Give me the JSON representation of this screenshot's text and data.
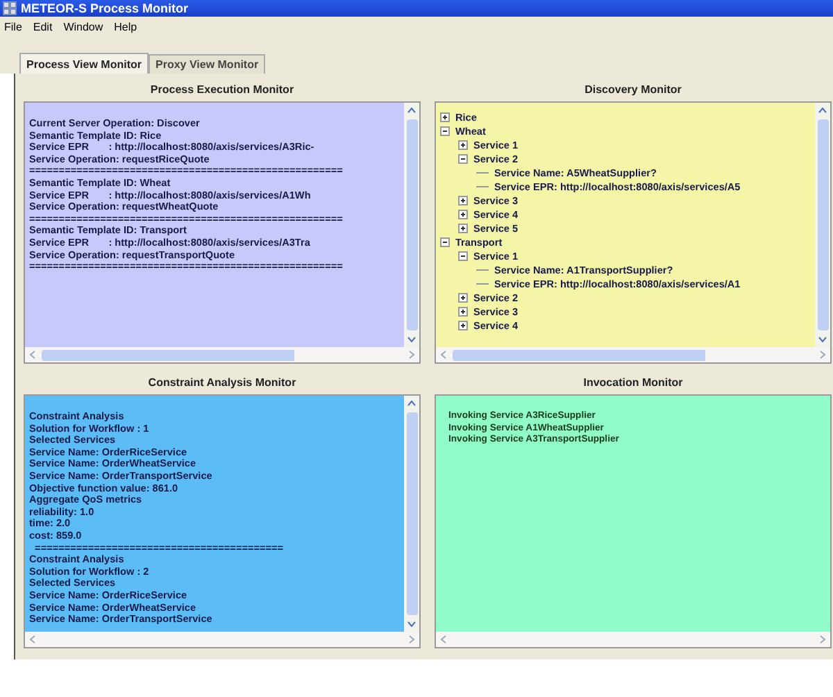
{
  "window": {
    "title": "METEOR-S Process Monitor"
  },
  "menu": [
    "File",
    "Edit",
    "Window",
    "Help"
  ],
  "tabs": [
    {
      "label": "Process View Monitor",
      "selected": true
    },
    {
      "label": "Proxy View Monitor",
      "selected": false
    }
  ],
  "panels": [
    {
      "title": "Process Execution Monitor",
      "kind": "text",
      "color": "#c8c8fa",
      "vertical_scrollbar": true,
      "lines": [
        "Current Server Operation: Discover",
        "Semantic Template ID: Rice",
        "Service EPR       : http://localhost:8080/axis/services/A3Ric-",
        "Service Operation: requestRiceQuote",
        "=====================================================",
        "Semantic Template ID: Wheat",
        "Service EPR       : http://localhost:8080/axis/services/A1Wh",
        "Service Operation: requestWheatQuote",
        "=====================================================",
        "Semantic Template ID: Transport",
        "Service EPR       : http://localhost:8080/axis/services/A3Tra",
        "Service Operation: requestTransportQuote",
        "====================================================="
      ]
    },
    {
      "title": "Discovery Monitor",
      "kind": "tree",
      "color": "#f5f5a8",
      "vertical_scrollbar": true,
      "nodes": [
        {
          "label": "Rice",
          "kind": "node",
          "expanded": false
        },
        {
          "label": "Wheat",
          "kind": "node",
          "expanded": true,
          "children": [
            {
              "label": "Service 1",
              "kind": "node",
              "expanded": false
            },
            {
              "label": "Service 2",
              "kind": "node",
              "expanded": true,
              "children": [
                {
                  "label": "Service Name: A5WheatSupplier?",
                  "kind": "leaf"
                },
                {
                  "label": "Service EPR: http://localhost:8080/axis/services/A5",
                  "kind": "leaf"
                }
              ]
            },
            {
              "label": "Service 3",
              "kind": "node",
              "expanded": false
            },
            {
              "label": "Service 4",
              "kind": "node",
              "expanded": false
            },
            {
              "label": "Service 5",
              "kind": "node",
              "expanded": false
            }
          ]
        },
        {
          "label": "Transport",
          "kind": "node",
          "expanded": true,
          "children": [
            {
              "label": "Service 1",
              "kind": "node",
              "expanded": true,
              "children": [
                {
                  "label": "Service Name: A1TransportSupplier?",
                  "kind": "leaf"
                },
                {
                  "label": "Service EPR: http://localhost:8080/axis/services/A1",
                  "kind": "leaf"
                }
              ]
            },
            {
              "label": "Service 2",
              "kind": "node",
              "expanded": false
            },
            {
              "label": "Service 3",
              "kind": "node",
              "expanded": false
            },
            {
              "label": "Service 4",
              "kind": "node",
              "expanded": false
            }
          ]
        }
      ]
    },
    {
      "title": "Constraint Analysis Monitor",
      "kind": "text",
      "color": "#5cbcf5",
      "vertical_scrollbar": true,
      "lines": [
        "Constraint Analysis",
        "Solution for Workflow : 1",
        "Selected Services",
        "Service Name: OrderRiceService",
        "Service Name: OrderWheatService",
        "Service Name: OrderTransportService",
        "Objective function value: 861.0",
        "Aggregate QoS metrics",
        "reliability: 1.0",
        "time: 2.0",
        "cost: 859.0",
        "  ==========================================",
        "Constraint Analysis",
        "Solution for Workflow : 2",
        "Selected Services",
        "Service Name: OrderRiceService",
        "Service Name: OrderWheatService",
        "Service Name: OrderTransportService"
      ]
    },
    {
      "title": "Invocation Monitor",
      "kind": "text",
      "color": "#90fcc8",
      "vertical_scrollbar": false,
      "lines": [
        "Invoking Service A3RiceSupplier",
        "Invoking Service A1WheatSupplier",
        "Invoking Service A3TransportSupplier"
      ]
    }
  ]
}
